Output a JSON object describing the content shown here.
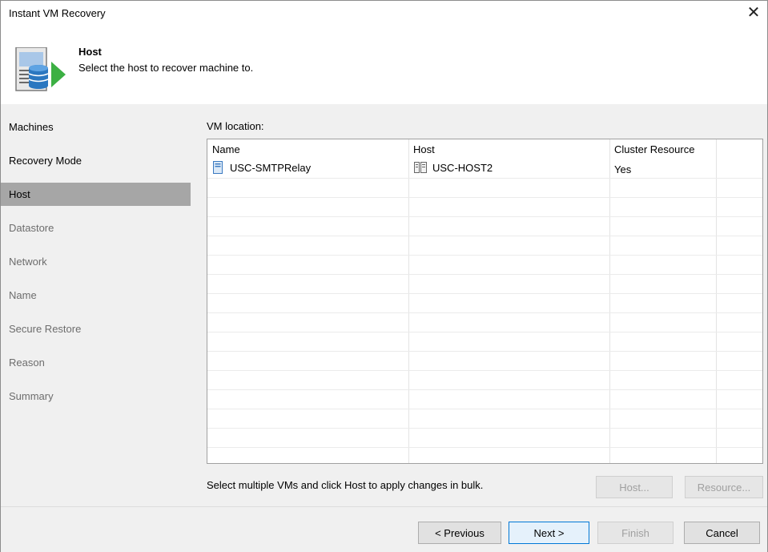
{
  "window": {
    "title": "Instant VM Recovery",
    "close_glyph": "✕"
  },
  "header": {
    "title": "Host",
    "subtitle": "Select the host to recover machine to."
  },
  "sidebar": {
    "items": [
      {
        "label": "Machines",
        "state": "done"
      },
      {
        "label": "Recovery Mode",
        "state": "done"
      },
      {
        "label": "Host",
        "state": "active"
      },
      {
        "label": "Datastore",
        "state": "pending"
      },
      {
        "label": "Network",
        "state": "pending"
      },
      {
        "label": "Name",
        "state": "pending"
      },
      {
        "label": "Secure Restore",
        "state": "pending"
      },
      {
        "label": "Reason",
        "state": "pending"
      },
      {
        "label": "Summary",
        "state": "pending"
      }
    ]
  },
  "main": {
    "location_label": "VM location:",
    "columns": [
      "Name",
      "Host",
      "Cluster Resource"
    ],
    "rows": [
      {
        "name": "USC-SMTPRelay",
        "name_icon": "vm-icon",
        "host": "USC-HOST2",
        "host_icon": "host-server-icon",
        "cluster": "Yes"
      }
    ],
    "hint": "Select multiple VMs and click Host to apply changes in bulk.",
    "host_button": "Host...",
    "resource_button": "Resource..."
  },
  "footer": {
    "previous": "< Previous",
    "next": "Next >",
    "finish": "Finish",
    "cancel": "Cancel"
  },
  "colors": {
    "accent": "#0078d7",
    "active_nav": "#a6a6a6",
    "panel_bg": "#f0f0f0",
    "icon_green": "#3cb043"
  }
}
